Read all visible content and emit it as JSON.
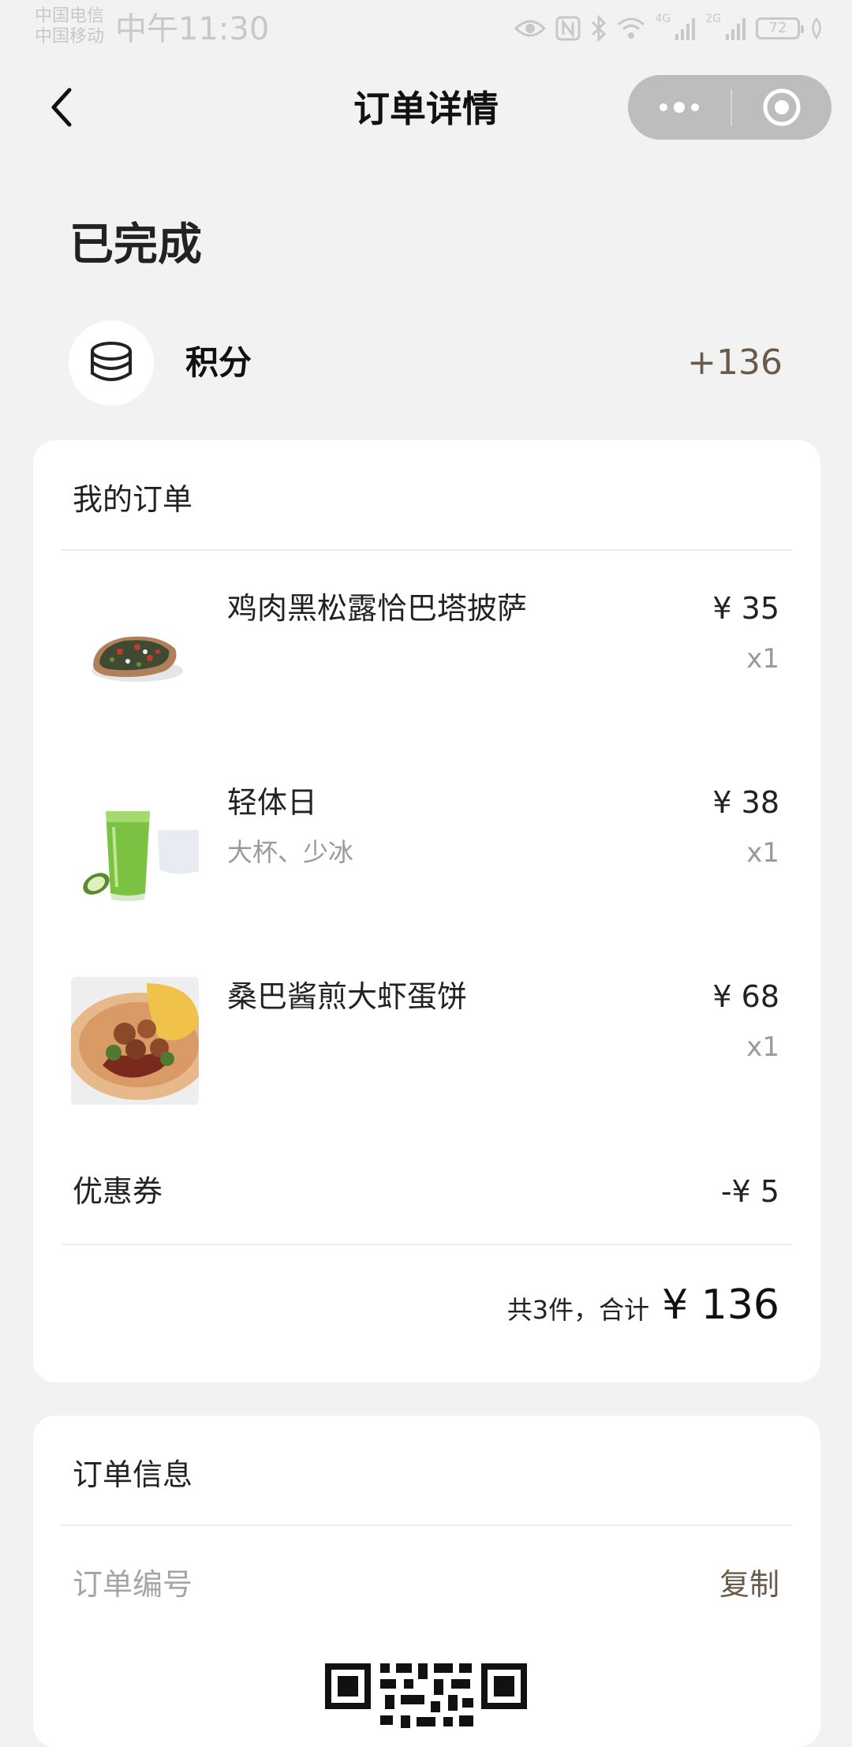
{
  "status_bar": {
    "carrier_1": "中国电信",
    "carrier_2": "中国移动",
    "time": "中午11:30",
    "network_1": "4G",
    "network_2": "2G",
    "battery": "72"
  },
  "nav": {
    "title": "订单详情"
  },
  "order": {
    "status": "已完成",
    "points_label": "积分",
    "points_value": "+136"
  },
  "order_card": {
    "title": "我的订单",
    "items": [
      {
        "name": "鸡肉黑松露恰巴塔披萨",
        "spec": "",
        "price": "¥ 35",
        "qty": "x1"
      },
      {
        "name": "轻体日",
        "spec": "大杯、少冰",
        "price": "¥ 38",
        "qty": "x1"
      },
      {
        "name": "桑巴酱煎大虾蛋饼",
        "spec": "",
        "price": "¥ 68",
        "qty": "x1"
      }
    ],
    "coupon_label": "优惠券",
    "coupon_value": "-¥ 5",
    "total_text": "共3件，合计",
    "total_amount": "¥ 136"
  },
  "info_card": {
    "title": "订单信息",
    "order_no_label": "订单编号",
    "copy_label": "复制"
  },
  "colors": {
    "background": "#f2f2f2",
    "accent_brown": "#6b5a4a",
    "muted_text": "#9a9a9a"
  },
  "icons": [
    "back-arrow-icon",
    "more-dots-icon",
    "capsule-close-icon",
    "coin-stack-icon",
    "qr-code-icon"
  ]
}
